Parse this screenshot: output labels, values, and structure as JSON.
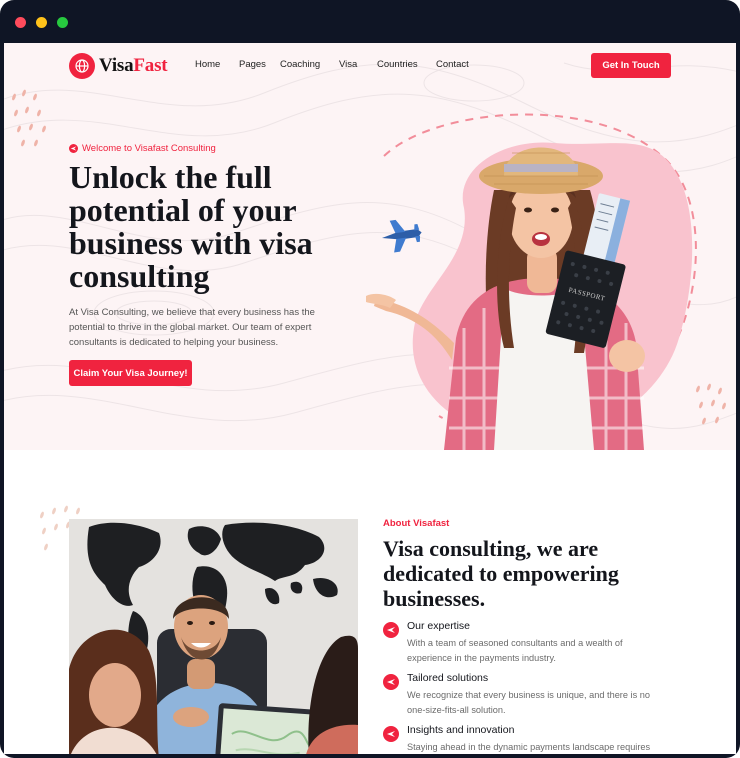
{
  "brand": {
    "name_part1": "Visa",
    "name_part2": "Fast",
    "accent": "#f0233f"
  },
  "nav": {
    "items": [
      "Home",
      "Pages",
      "Coaching",
      "Visa",
      "Countries",
      "Contact"
    ]
  },
  "header": {
    "cta_label": "Get In Touch"
  },
  "hero": {
    "eyebrow": "Welcome to Visafast Consulting",
    "title": "Unlock the full potential of your business with visa consulting",
    "description": "At Visa Consulting, we believe that every business has the potential to thrive in the global market. Our team of expert consultants is dedicated to helping your business.",
    "cta_label": "Claim Your Visa Journey!",
    "passport_label": "PASSPORT",
    "icons": [
      "plane-icon",
      "globe-icon"
    ]
  },
  "about": {
    "eyebrow": "About Visafast",
    "title": "Visa consulting, we are dedicated to empowering businesses.",
    "features": [
      {
        "title": "Our expertise",
        "text": "With a team of seasoned consultants and a wealth of experience in the payments industry."
      },
      {
        "title": "Tailored solutions",
        "text": "We recognize that every business is unique, and there is no one-size-fits-all solution."
      },
      {
        "title": "Insights and innovation",
        "text": "Staying ahead in the dynamic payments landscape requires"
      }
    ]
  }
}
